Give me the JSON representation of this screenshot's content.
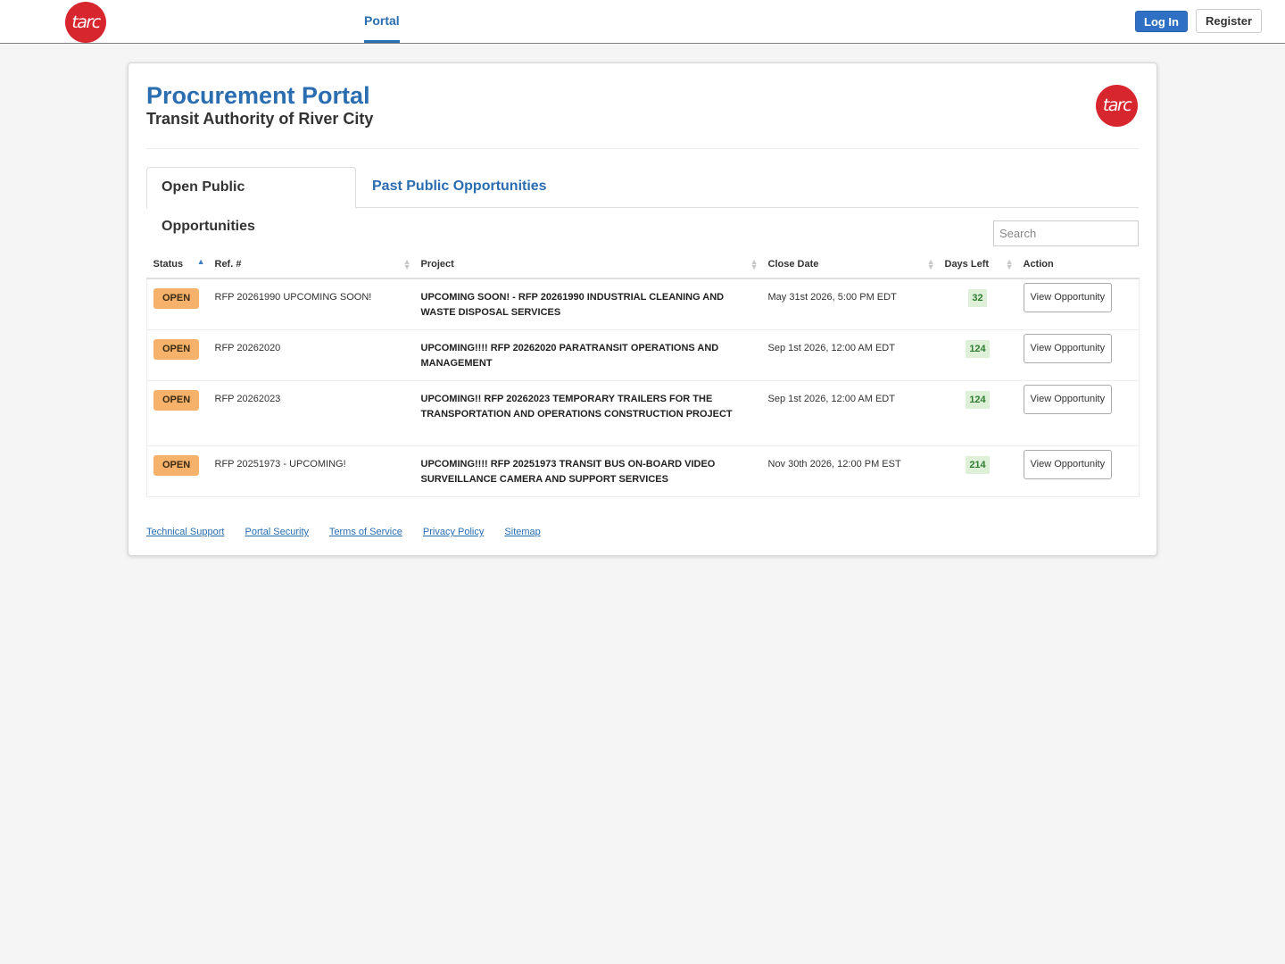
{
  "header": {
    "logo_text": "tarc",
    "nav_tab": "Portal",
    "login_label": "Log In",
    "register_label": "Register"
  },
  "page": {
    "title": "Procurement Portal",
    "subtitle": "Transit Authority of River City",
    "logo_text": "tarc"
  },
  "tabs": [
    {
      "label": "Open Public Opportunities",
      "active": true
    },
    {
      "label": "Past Public Opportunities",
      "active": false
    }
  ],
  "search": {
    "placeholder": "Search"
  },
  "table": {
    "columns": [
      "Status",
      "Ref. #",
      "Project",
      "Close Date",
      "Days Left",
      "Action"
    ],
    "rows": [
      {
        "status": "OPEN",
        "ref": "RFP 20261990 UPCOMING SOON!",
        "project": "UPCOMING SOON! - RFP 20261990 INDUSTRIAL CLEANING AND WASTE DISPOSAL SERVICES",
        "close_date": "May 31st 2026, 5:00 PM EDT",
        "days_left": "32",
        "action": "View Opportunity"
      },
      {
        "status": "OPEN",
        "ref": "RFP 20262020",
        "project": "UPCOMING!!!! RFP 20262020 PARATRANSIT OPERATIONS AND MANAGEMENT",
        "close_date": "Sep 1st 2026, 12:00 AM EDT",
        "days_left": "124",
        "action": "View Opportunity"
      },
      {
        "status": "OPEN",
        "ref": "RFP 20262023",
        "project": "UPCOMING!! RFP 20262023 TEMPORARY TRAILERS FOR THE TRANSPORTATION AND OPERATIONS CONSTRUCTION PROJECT",
        "close_date": "Sep 1st 2026, 12:00 AM EDT",
        "days_left": "124",
        "action": "View Opportunity"
      },
      {
        "status": "OPEN",
        "ref": "RFP 20251973 - UPCOMING!",
        "project": "UPCOMING!!!! RFP 20251973 TRANSIT BUS ON-BOARD VIDEO SURVEILLANCE CAMERA AND SUPPORT SERVICES",
        "close_date": "Nov 30th 2026, 12:00 PM EST",
        "days_left": "214",
        "action": "View Opportunity"
      }
    ]
  },
  "footer": {
    "links": [
      "Technical Support",
      "Portal Security",
      "Terms of Service",
      "Privacy Policy",
      "Sitemap"
    ]
  },
  "colors": {
    "brand_blue": "#2a6db0",
    "logo_red": "#d7262e",
    "open_badge": "#f6b26b",
    "days_badge_bg": "#dff0d8"
  },
  "icons": {
    "sort_active": "sort-asc-icon",
    "sort_inactive": "sort-both-icon"
  }
}
